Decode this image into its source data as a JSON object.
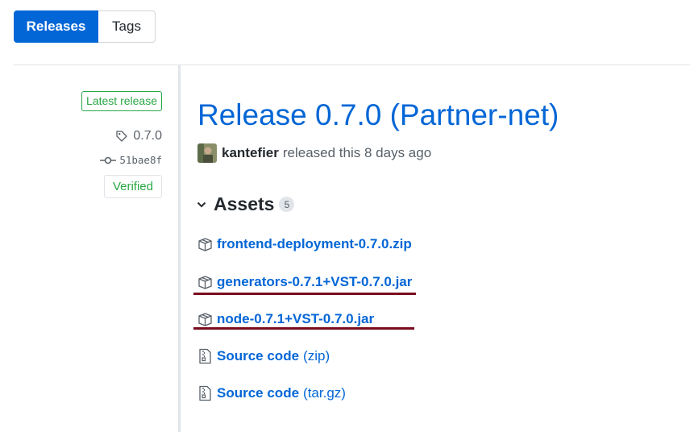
{
  "tabs": {
    "releases": "Releases",
    "tags": "Tags"
  },
  "sidebar": {
    "latest_badge": "Latest release",
    "tag": "0.7.0",
    "commit": "51bae8f",
    "verified": "Verified"
  },
  "release": {
    "title": "Release 0.7.0 (Partner-net)",
    "author": "kantefier",
    "byline_text": "released this 8 days ago"
  },
  "assets": {
    "heading": "Assets",
    "count": "5",
    "items": [
      {
        "name": "frontend-deployment-0.7.0.zip",
        "icon": "package-icon"
      },
      {
        "name": "generators-0.7.1+VST-0.7.0.jar",
        "icon": "package-icon"
      },
      {
        "name": "node-0.7.1+VST-0.7.0.jar",
        "icon": "package-icon"
      },
      {
        "name": "Source code",
        "ext": "(zip)",
        "icon": "file-zip-icon"
      },
      {
        "name": "Source code",
        "ext": "(tar.gz)",
        "icon": "file-zip-icon"
      }
    ]
  },
  "colors": {
    "link": "#0366d6",
    "success": "#28a745",
    "annotation": "#7a0c1e"
  }
}
